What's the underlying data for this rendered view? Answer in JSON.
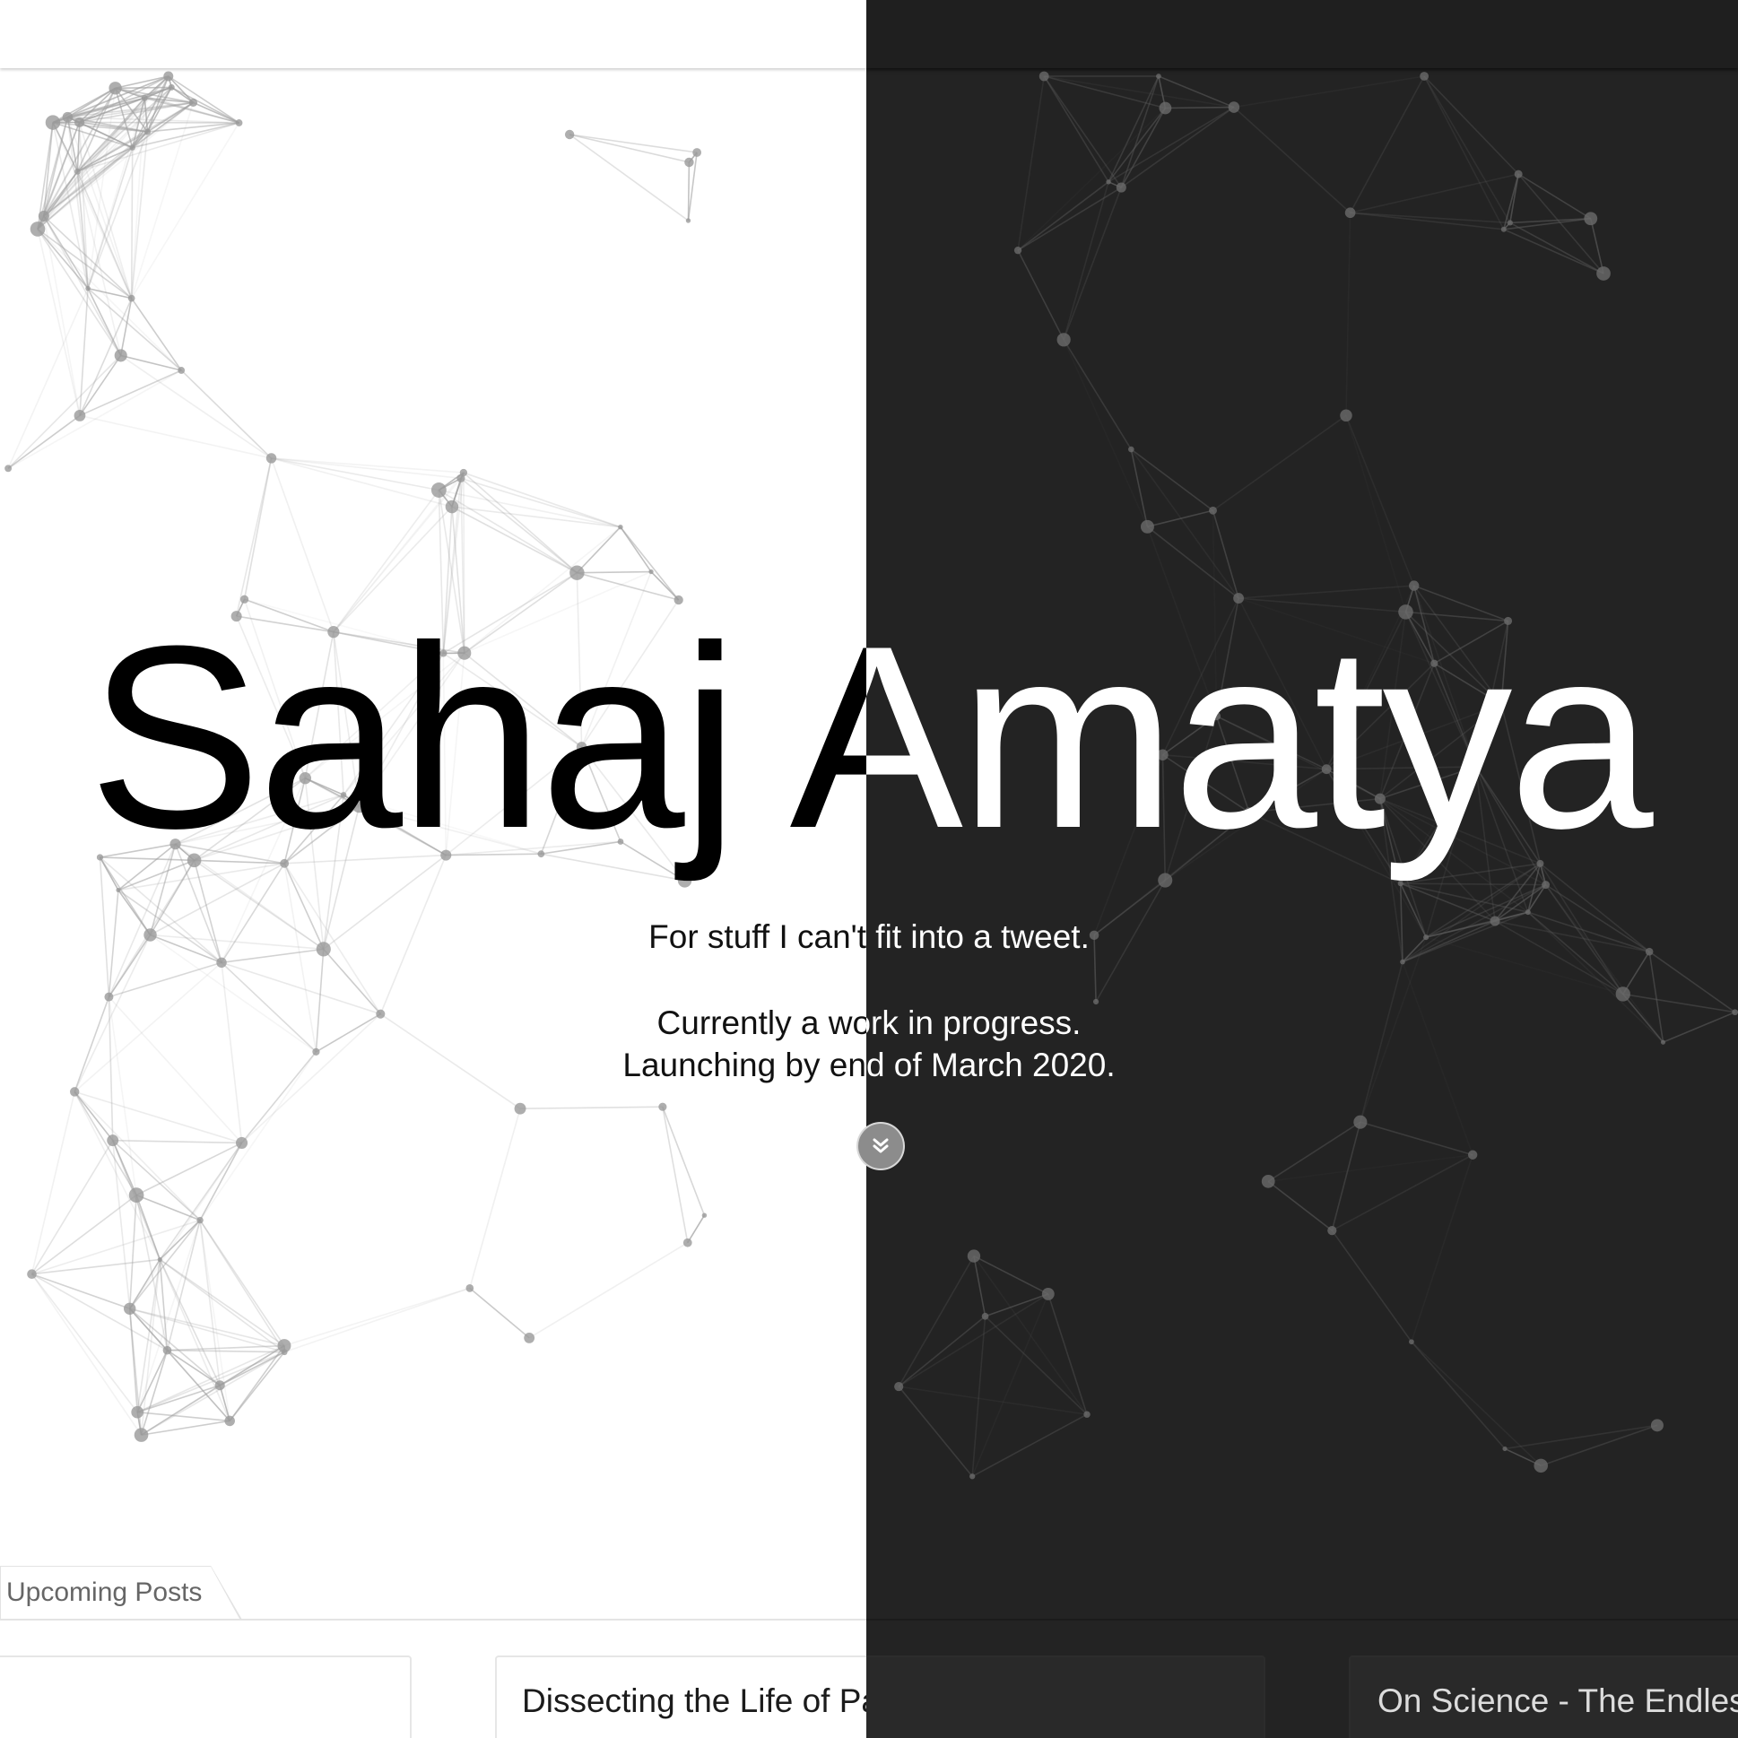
{
  "hero": {
    "title": "Sahaj Amatya",
    "tagline": "For stuff I can't fit into a tweet.",
    "status_line_1": "Currently a work in progress.",
    "status_line_2": "Launching by end of March 2020."
  },
  "scroll_button": {
    "icon": "double-chevron-down-icon"
  },
  "posts": {
    "tab_label": "Upcoming Posts",
    "items": [
      {
        "title": ""
      },
      {
        "title": "Dissecting the Life of Pablo"
      },
      {
        "title": "On Science - The Endles"
      }
    ]
  },
  "theme": {
    "light_background": "#ffffff",
    "dark_background": "#232323",
    "light_text": "#000000",
    "dark_text": "#ffffff"
  }
}
